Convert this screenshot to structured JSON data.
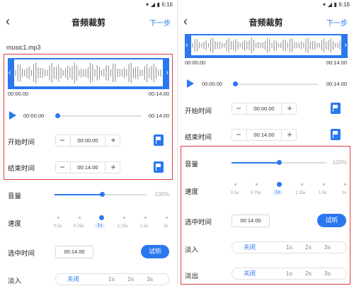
{
  "status": {
    "time": "6:16"
  },
  "nav": {
    "title": "音频裁剪",
    "next": "下一步"
  },
  "left": {
    "filename": "music1.mp3",
    "wave_start": "00:00.00",
    "wave_end": "00:14.00",
    "player_time_start": "00:00.00",
    "player_time_end": "00:14.00",
    "start_label": "开始时间",
    "start_value": "00:00.00",
    "end_label": "结束时间",
    "end_value": "00:14.00",
    "volume_label": "音量",
    "volume_pct": "100%",
    "speed_label": "速度",
    "speeds": [
      "0.5x",
      "0.75x",
      "1x",
      "1.25x",
      "1.5x",
      "2x"
    ],
    "selected_label": "选中时间",
    "selected_value": "00:14.00",
    "listen": "试听",
    "fadein_label": "淡入",
    "fade_options": [
      "关闭",
      "1s",
      "2s",
      "3s"
    ]
  },
  "right": {
    "wave_start": "00:00.00",
    "wave_end": "00:14.00",
    "player_time_start": "00:00.00",
    "player_time_end": "00:14.00",
    "start_label": "开始时间",
    "start_value": "00:00.00",
    "end_label": "结束时间",
    "end_value": "00:14.00",
    "volume_label": "音量",
    "volume_pct": "100%",
    "speed_label": "速度",
    "speeds": [
      "0.5x",
      "0.75x",
      "1x",
      "1.25x",
      "1.5x",
      "2x"
    ],
    "selected_label": "选中时间",
    "selected_value": "00:14.00",
    "listen": "试听",
    "fadein_label": "淡入",
    "fadeout_label": "淡出",
    "fade_options": [
      "关闭",
      "1s",
      "2s",
      "3s"
    ]
  },
  "colors": {
    "accent": "#2a78f0",
    "highlight_border": "#e03c3c"
  }
}
